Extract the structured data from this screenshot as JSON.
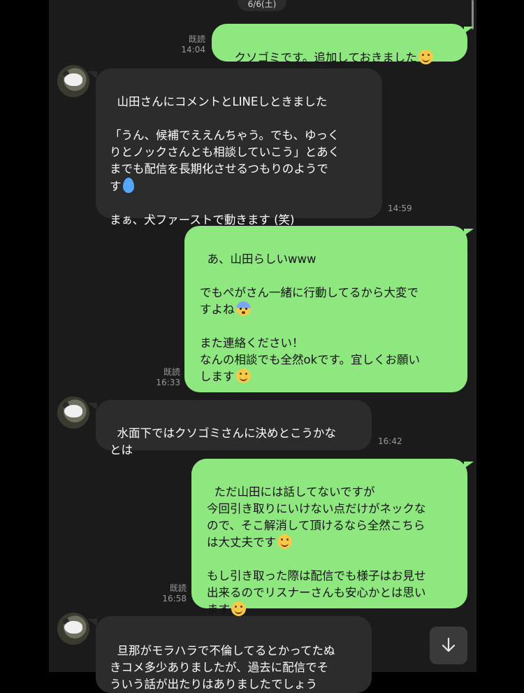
{
  "date_label": "6/6(土)",
  "messages": [
    {
      "id": "m1",
      "read": "既読",
      "time": "14:04",
      "text": "クソゴミです。追加しておきました"
    },
    {
      "id": "m2",
      "time": "14:59",
      "text": "山田さんにコメントとLINEしときました\n\n「うん、候補でええんちゃう。でも、ゆっく\nりとノックさんとも相談していこう」とあく\nまでも配信を長期化させるつもりのようで\nす",
      "text2": "まぁ、犬ファーストで動きます (笑)"
    },
    {
      "id": "m3",
      "read": "既読",
      "time": "16:33",
      "text": "あ、山田らしいwww\n\nでもぺがさん一緒に行動してるから大変で\nすよね",
      "text2": "また連絡ください！\nなんの相談でも全然okです。宜しくお願い\nします"
    },
    {
      "id": "m4",
      "time": "16:42",
      "text": "水面下ではクソゴミさんに決めとこうかな\nとは"
    },
    {
      "id": "m5",
      "read": "既読",
      "time": "16:58",
      "text": "ただ山田には話してないですが\n今回引き取りにいけない点だけがネックな\nので、そこ解消して頂けるなら全然こちら\nは大丈夫です",
      "text2": "もし引き取った際は配信でも様子はお見せ\n出来るのでリスナーさんも安心かとは思い\nます"
    },
    {
      "id": "m6",
      "text": "旦那がモラハラで不倫してるとかってたぬ\nきコメ多少ありましたが、過去に配信でそ\nういう話が出たりはありましたでしょう"
    }
  ],
  "icons": {
    "scroll_down": "arrow-down-icon",
    "avatar": "dog-avatar"
  },
  "colors": {
    "outgoing_bubble": "#8fe77f",
    "incoming_bubble": "#2c2c2c",
    "background": "#1b1b1b"
  }
}
